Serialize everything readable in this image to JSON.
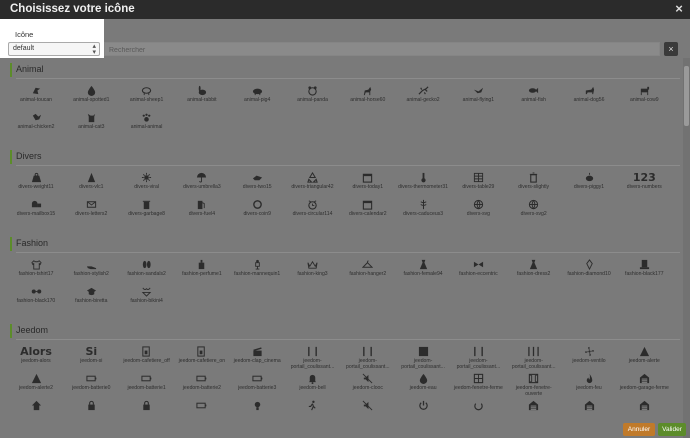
{
  "dialog": {
    "title": "Choisissez votre icône",
    "close_glyph": "×"
  },
  "filter": {
    "label": "Icône",
    "select_value": "default",
    "search_placeholder": "Rechercher",
    "clear_glyph": "×"
  },
  "sections": [
    {
      "title": "Animal",
      "icons": [
        {
          "label": "animal-toucan",
          "icon": "toucan"
        },
        {
          "label": "animal-spotted1",
          "icon": "drop"
        },
        {
          "label": "animal-sheep1",
          "icon": "sheep"
        },
        {
          "label": "animal-rabbit",
          "icon": "rabbit"
        },
        {
          "label": "animal-pig4",
          "icon": "pig"
        },
        {
          "label": "animal-panda",
          "icon": "panda"
        },
        {
          "label": "animal-horse60",
          "icon": "horse"
        },
        {
          "label": "animal-gecko2",
          "icon": "gecko"
        },
        {
          "label": "animal-flying1",
          "icon": "bird"
        },
        {
          "label": "animal-fish",
          "icon": "fish"
        },
        {
          "label": "animal-dog56",
          "icon": "dog"
        },
        {
          "label": "animal-cow9",
          "icon": "cow"
        },
        {
          "label": "animal-chicken2",
          "icon": "chicken"
        },
        {
          "label": "animal-cat3",
          "icon": "cat"
        },
        {
          "label": "animal-animal",
          "icon": "paw"
        }
      ]
    },
    {
      "title": "Divers",
      "icons": [
        {
          "label": "divers-weight11",
          "icon": "weight"
        },
        {
          "label": "divers-vlc1",
          "icon": "cone"
        },
        {
          "label": "divers-viral",
          "icon": "virus"
        },
        {
          "label": "divers-umbrella3",
          "icon": "umbrella"
        },
        {
          "label": "divers-two15",
          "icon": "hands"
        },
        {
          "label": "divers-triangular42",
          "icon": "recycle"
        },
        {
          "label": "divers-today1",
          "icon": "calendar"
        },
        {
          "label": "divers-thermometer31",
          "icon": "thermometer"
        },
        {
          "label": "divers-table29",
          "icon": "table"
        },
        {
          "label": "divers-slightly",
          "icon": "trash"
        },
        {
          "label": "divers-piggy1",
          "icon": "piggy"
        },
        {
          "label": "divers-numbers",
          "icon": "text:123"
        },
        {
          "label": "divers-mailbox15",
          "icon": "mailbox"
        },
        {
          "label": "divers-letters2",
          "icon": "letters"
        },
        {
          "label": "divers-garbage8",
          "icon": "garbage"
        },
        {
          "label": "divers-fuel4",
          "icon": "fuel"
        },
        {
          "label": "divers-coin9",
          "icon": "coin"
        },
        {
          "label": "divers-circular114",
          "icon": "alarm"
        },
        {
          "label": "divers-calendar2",
          "icon": "calendar"
        },
        {
          "label": "divers-caduceus3",
          "icon": "caduceus"
        },
        {
          "label": "divers-svg",
          "icon": "globe"
        },
        {
          "label": "divers-svg2",
          "icon": "globe"
        }
      ]
    },
    {
      "title": "Fashion",
      "icons": [
        {
          "label": "fashion-tshirt17",
          "icon": "tshirt"
        },
        {
          "label": "fashion-stylish2",
          "icon": "heel"
        },
        {
          "label": "fashion-sandals2",
          "icon": "sandals"
        },
        {
          "label": "fashion-perfume1",
          "icon": "perfume"
        },
        {
          "label": "fashion-mannequin1",
          "icon": "mannequin"
        },
        {
          "label": "fashion-king3",
          "icon": "crown"
        },
        {
          "label": "fashion-hanger2",
          "icon": "hanger"
        },
        {
          "label": "fashion-female94",
          "icon": "dress"
        },
        {
          "label": "fashion-eccentric",
          "icon": "bowtie"
        },
        {
          "label": "fashion-dress2",
          "icon": "dress"
        },
        {
          "label": "fashion-diamond10",
          "icon": "diamond"
        },
        {
          "label": "fashion-black177",
          "icon": "hat"
        },
        {
          "label": "fashion-black170",
          "icon": "glasses"
        },
        {
          "label": "fashion-biretta",
          "icon": "cap"
        },
        {
          "label": "fashion-bikini4",
          "icon": "bikini"
        }
      ]
    },
    {
      "title": "Jeedom",
      "icons": [
        {
          "label": "jeedom-alors",
          "icon": "text:Alors"
        },
        {
          "label": "jeedom-si",
          "icon": "text:Si"
        },
        {
          "label": "jeedom-cafetiere_off",
          "icon": "coffee"
        },
        {
          "label": "jeedom-cafetiere_on",
          "icon": "coffee"
        },
        {
          "label": "jeedom-clap_cinema",
          "icon": "clap"
        },
        {
          "label": "jeedom-portail_coulissant...",
          "icon": "gate"
        },
        {
          "label": "jeedom-portail_coulissant...",
          "icon": "gate"
        },
        {
          "label": "jeedom-portail_coulissant...",
          "icon": "gate-full"
        },
        {
          "label": "jeedom-portail_coulissant...",
          "icon": "gate"
        },
        {
          "label": "jeedom-portail_coulissant...",
          "icon": "gate-open"
        },
        {
          "label": "jeedom-ventilo",
          "icon": "fan"
        },
        {
          "label": "jeedom-alerte",
          "icon": "alert"
        },
        {
          "label": "jeedom-alerte2",
          "icon": "alert"
        },
        {
          "label": "jeedom-batterie0",
          "icon": "battery"
        },
        {
          "label": "jeedom-batterie1",
          "icon": "battery"
        },
        {
          "label": "jeedom-batterie2",
          "icon": "battery"
        },
        {
          "label": "jeedom-batterie3",
          "icon": "battery"
        },
        {
          "label": "jeedom-bell",
          "icon": "bell"
        },
        {
          "label": "jeedom-clooc",
          "icon": "mute"
        },
        {
          "label": "jeedom-eau",
          "icon": "drop"
        },
        {
          "label": "jeedom-fenetre-ferme",
          "icon": "window"
        },
        {
          "label": "jeedom-fenetre-ouverte",
          "icon": "window-open"
        },
        {
          "label": "jeedom-feu",
          "icon": "flame"
        },
        {
          "label": "jeedom-garage-ferme",
          "icon": "garage"
        },
        {
          "label": "",
          "icon": "house"
        },
        {
          "label": "",
          "icon": "lock"
        },
        {
          "label": "",
          "icon": "lock"
        },
        {
          "label": "",
          "icon": "battery"
        },
        {
          "label": "",
          "icon": "bulb"
        },
        {
          "label": "",
          "icon": "runner"
        },
        {
          "label": "",
          "icon": "mute"
        },
        {
          "label": "",
          "icon": "power"
        },
        {
          "label": "",
          "icon": "arc"
        },
        {
          "label": "",
          "icon": "garage"
        },
        {
          "label": "",
          "icon": "garage"
        },
        {
          "label": "",
          "icon": "garage"
        }
      ]
    }
  ],
  "footer": {
    "cancel_label": "Annuler",
    "validate_label": "Valider"
  },
  "colors": {
    "accent_green": "#5c8c2a",
    "cancel_orange": "#c07a2a",
    "overlay": "#7a7a7a",
    "titlebar": "#2b2b2b"
  }
}
